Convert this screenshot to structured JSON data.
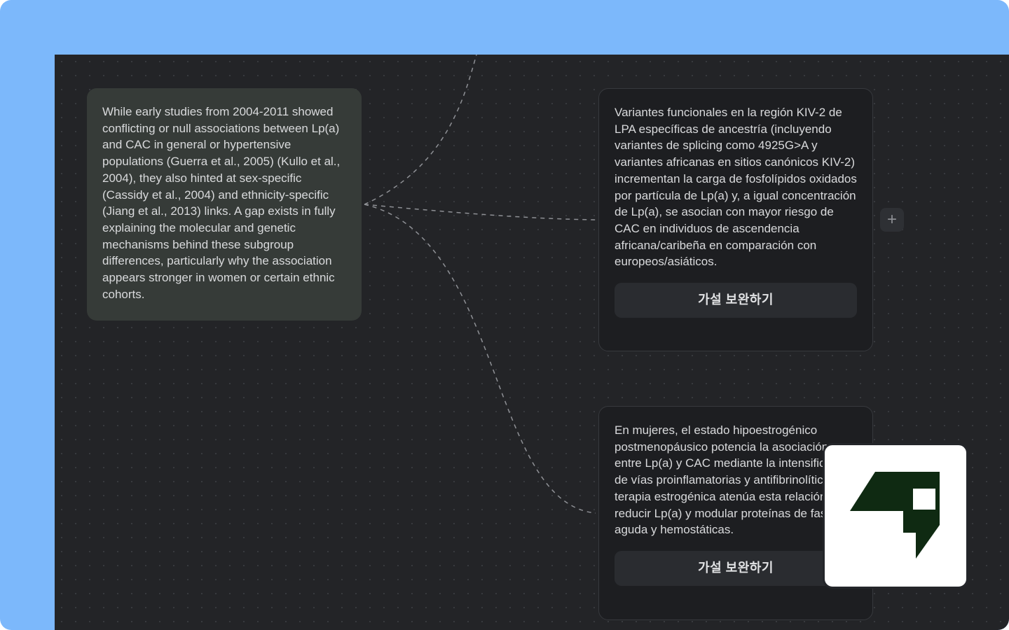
{
  "canvas": {
    "source_node": {
      "text": "While early studies from 2004-2011 showed conflicting or null associations between Lp(a) and CAC in general or hypertensive populations (Guerra et al., 2005) (Kullo et al., 2004), they also hinted at sex-specific (Cassidy et al., 2004) and ethnicity-specific (Jiang et al., 2013) links. A gap exists in fully explaining the molecular and genetic mechanisms behind these subgroup differences, particularly why the association appears stronger in women or certain ethnic cohorts."
    },
    "hypotheses": [
      {
        "text": "Variantes funcionales en la región KIV-2 de LPA específicas de ancestría (incluyendo variantes de splicing como 4925G>A y variantes africanas en sitios canónicos KIV-2) incrementan la carga de fosfolípidos oxidados por partícula de Lp(a) y, a igual concentración de Lp(a), se asocian con mayor riesgo de CAC en individuos de ascendencia africana/caribeña en comparación con europeos/asiáticos.",
        "button_label": "가설 보완하기"
      },
      {
        "text": "En mujeres, el estado hipoestrogénico postmenopáusico potencia la asociación entre Lp(a) y CAC mediante la intensificación de vías proinflamatorias y antifibrinolíticas; la terapia estrogénica atenúa esta relación al reducir Lp(a) y modular proteínas de fase aguda y hemostáticas.",
        "button_label": "가설 보완하기"
      }
    ],
    "add_node_icon": "plus-icon"
  },
  "logo": {
    "icon": "brand-logo-icon",
    "color": "#0f2a12"
  },
  "colors": {
    "frame": "#7cb8fb",
    "canvas": "#232427",
    "source_node": "#363b38",
    "hypothesis_node": "#1d1e21",
    "button": "#2a2c30"
  }
}
